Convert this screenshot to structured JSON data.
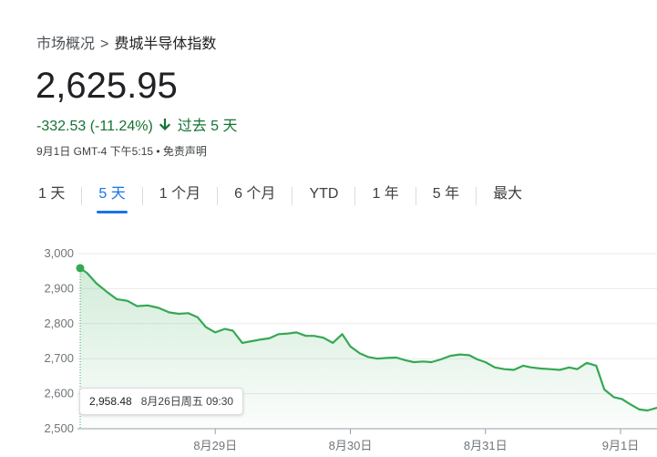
{
  "breadcrumb": {
    "parent": "市场概况",
    "separator": ">",
    "current": "费城半导体指数"
  },
  "quote": {
    "price": "2,625.95",
    "change": "-332.53 (-11.24%)",
    "period": "过去 5 天",
    "meta": "9月1日 GMT-4 下午5:15 • 免责声明"
  },
  "tabs": [
    {
      "label": "1 天",
      "active": false
    },
    {
      "label": "5 天",
      "active": true
    },
    {
      "label": "1 个月",
      "active": false
    },
    {
      "label": "6 个月",
      "active": false
    },
    {
      "label": "YTD",
      "active": false
    },
    {
      "label": "1 年",
      "active": false
    },
    {
      "label": "5 年",
      "active": false
    },
    {
      "label": "最大",
      "active": false
    }
  ],
  "tooltip": {
    "value": "2,958.48",
    "datetime": "8月26日周五 09:30"
  },
  "colors": {
    "line": "#34a853",
    "negative": "#137333",
    "accent": "#1a73e8"
  },
  "chart_data": {
    "type": "line",
    "ylim": [
      2500,
      3000
    ],
    "yticks": [
      3000,
      2900,
      2800,
      2700,
      2600,
      2500
    ],
    "ytick_labels": [
      "3,000",
      "2,900",
      "2,800",
      "2,700",
      "2,600",
      "2,500"
    ],
    "x_label_positions": [
      1,
      2,
      3,
      4
    ],
    "x_labels": [
      "8月29日",
      "8月30日",
      "8月31日",
      "9月1日"
    ],
    "x_range": [
      0,
      4.27
    ],
    "grid": true,
    "series": [
      {
        "x": [
          0.0,
          0.05,
          0.12,
          0.2,
          0.27,
          0.35,
          0.42,
          0.5,
          0.58,
          0.66,
          0.73,
          0.8,
          0.87,
          0.93,
          1.0,
          1.07,
          1.13,
          1.2,
          1.27,
          1.34,
          1.4,
          1.47,
          1.54,
          1.6,
          1.67,
          1.73,
          1.8,
          1.87,
          1.94,
          2.0,
          2.07,
          2.13,
          2.2,
          2.27,
          2.34,
          2.41,
          2.47,
          2.54,
          2.6,
          2.67,
          2.74,
          2.81,
          2.88,
          2.94,
          3.0,
          3.07,
          3.14,
          3.21,
          3.28,
          3.34,
          3.41,
          3.48,
          3.55,
          3.62,
          3.68,
          3.75,
          3.82,
          3.88,
          3.95,
          4.01,
          4.07,
          4.14,
          4.2,
          4.27
        ],
        "y": [
          2958,
          2945,
          2915,
          2890,
          2870,
          2865,
          2850,
          2852,
          2845,
          2832,
          2828,
          2830,
          2818,
          2790,
          2775,
          2785,
          2780,
          2745,
          2750,
          2755,
          2758,
          2770,
          2772,
          2775,
          2765,
          2765,
          2760,
          2745,
          2770,
          2735,
          2715,
          2705,
          2700,
          2702,
          2703,
          2695,
          2690,
          2692,
          2690,
          2698,
          2708,
          2712,
          2710,
          2698,
          2690,
          2675,
          2670,
          2668,
          2680,
          2675,
          2672,
          2670,
          2668,
          2675,
          2670,
          2688,
          2680,
          2612,
          2590,
          2585,
          2570,
          2555,
          2552,
          2560
        ],
        "start": {
          "x": 0.0,
          "y": 2958.48
        }
      }
    ]
  }
}
